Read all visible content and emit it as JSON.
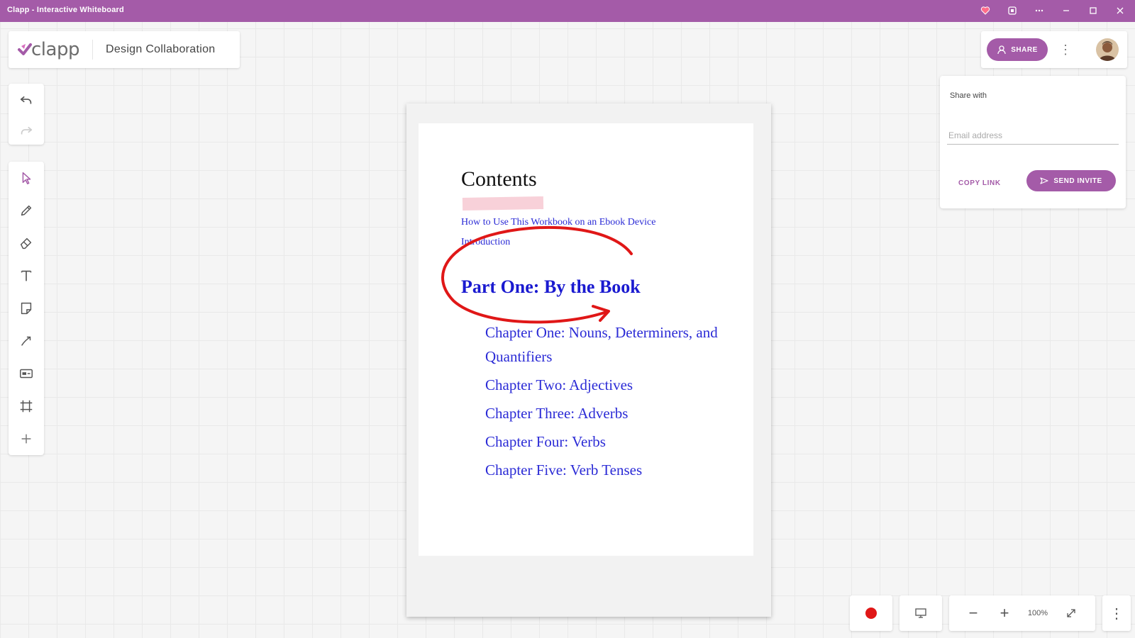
{
  "window": {
    "title": "Clapp - Interactive Whiteboard",
    "accent_color": "#a45ba8",
    "controls": [
      "heart-pin-icon",
      "extension-icon",
      "more-horizontal-icon",
      "minimize-icon",
      "maximize-icon",
      "close-icon"
    ]
  },
  "brand": {
    "logo_text": "clapp",
    "board_name": "Design Collaboration"
  },
  "toolbar_history": [
    "undo-icon",
    "redo-icon"
  ],
  "toolbar_tools": [
    "select-icon",
    "pen-icon",
    "eraser-icon",
    "text-icon",
    "sticky-note-icon",
    "connector-icon",
    "media-icon",
    "frame-icon",
    "add-icon"
  ],
  "header_actions": {
    "share_label": "SHARE",
    "more_icon": "more-vertical-icon",
    "avatar": "user-avatar"
  },
  "share_panel": {
    "label": "Share with",
    "email_placeholder": "Email address",
    "email_value": "",
    "copy_link_label": "COPY LINK",
    "send_invite_label": "SEND INVITE"
  },
  "document": {
    "title": "Contents",
    "toc_small": [
      "How to Use This Workbook on an Ebook Device",
      "Introduction"
    ],
    "part_heading": "Part One: By the Book",
    "chapters": [
      "Chapter One: Nouns, Determiners, and Quantifiers",
      "Chapter Two: Adjectives",
      "Chapter Three: Adverbs",
      "Chapter Four: Verbs",
      "Chapter Five: Verb Tenses"
    ],
    "link_color": "#2b2bd6",
    "annotation_color": "#e01717",
    "highlight_color": "#f6c1cc"
  },
  "bottom_bar": {
    "record_icon": "record-icon",
    "present_icon": "present-icon",
    "zoom_out_icon": "zoom-out-icon",
    "zoom_in_icon": "zoom-in-icon",
    "zoom_level": "100%",
    "fit_icon": "fit-screen-icon",
    "more_icon": "more-vertical-icon"
  }
}
